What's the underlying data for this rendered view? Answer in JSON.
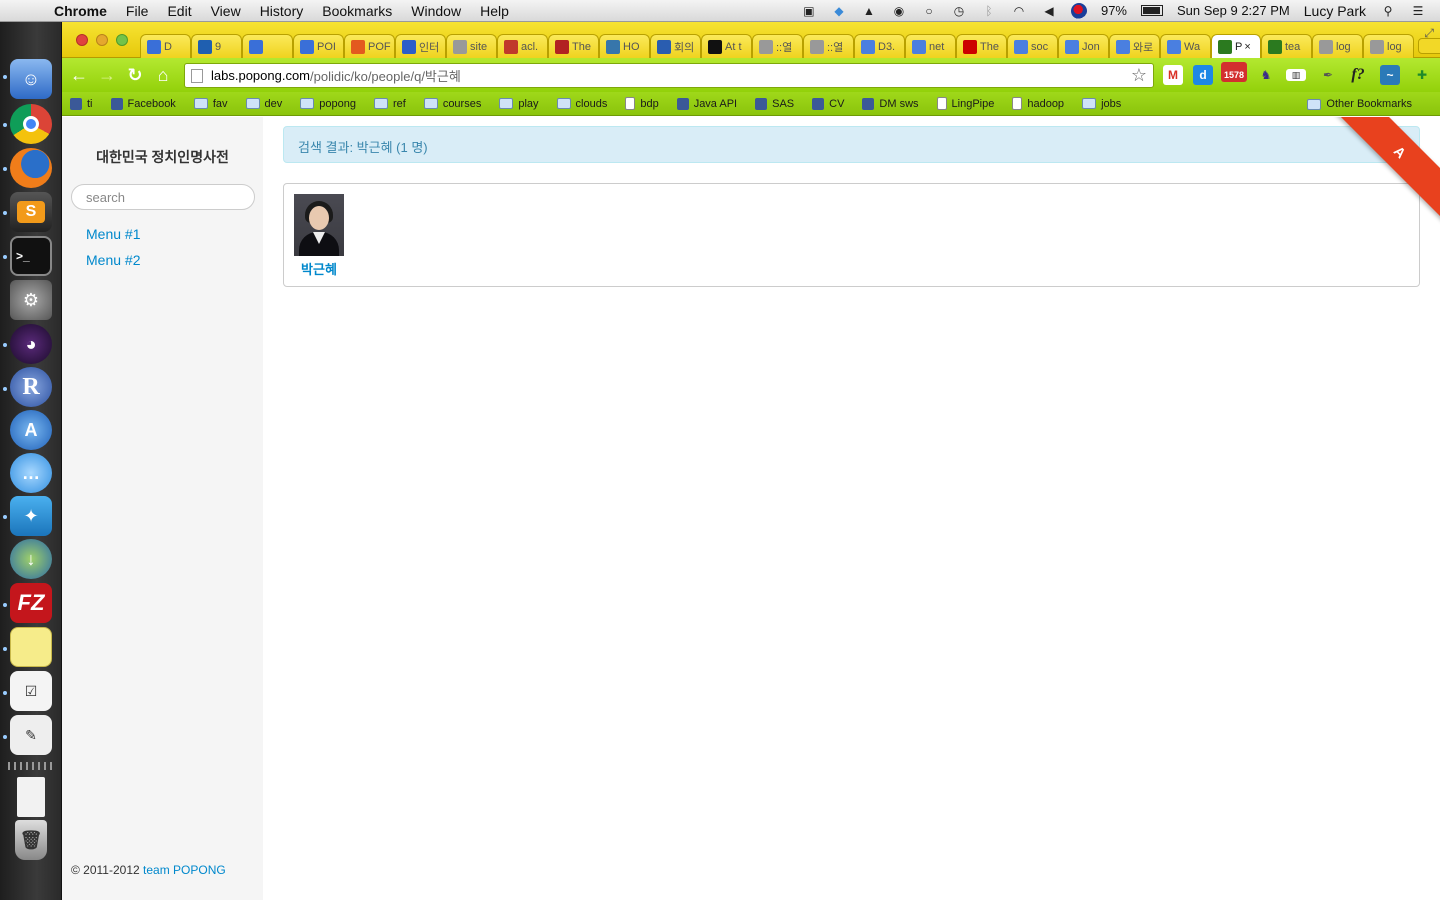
{
  "menubar": {
    "app_name": "Chrome",
    "menus": [
      "File",
      "Edit",
      "View",
      "History",
      "Bookmarks",
      "Window",
      "Help"
    ],
    "battery": "97%",
    "datetime": "Sun Sep 9  2:27 PM",
    "user": "Lucy Park"
  },
  "tabs": [
    {
      "label": "D",
      "color": "#3a6fd8"
    },
    {
      "label": "9",
      "color": "#1f5fb0"
    },
    {
      "label": "",
      "color": "#3a6fd8"
    },
    {
      "label": "POI",
      "color": "#3a6fd8"
    },
    {
      "label": "POF",
      "color": "#e35a1f"
    },
    {
      "label": "인터",
      "color": "#2c5ec9"
    },
    {
      "label": "site",
      "color": "#999999"
    },
    {
      "label": "acl.",
      "color": "#c0392b"
    },
    {
      "label": "The",
      "color": "#b22222"
    },
    {
      "label": "HO",
      "color": "#3776ab"
    },
    {
      "label": "회의",
      "color": "#2a5db0"
    },
    {
      "label": "At t",
      "color": "#111111"
    },
    {
      "label": "::열",
      "color": "#999999"
    },
    {
      "label": "::열",
      "color": "#999999"
    },
    {
      "label": "D3.",
      "color": "#4a7fe0"
    },
    {
      "label": "net",
      "color": "#4a7fe0"
    },
    {
      "label": "The",
      "color": "#cc0000"
    },
    {
      "label": "soc",
      "color": "#4a7fe0"
    },
    {
      "label": "Jon",
      "color": "#4a7fe0"
    },
    {
      "label": "와로",
      "color": "#4a7fe0"
    },
    {
      "label": "Wa",
      "color": "#4a7fe0"
    },
    {
      "label": "P",
      "color": "#2b7a1f",
      "active": true
    },
    {
      "label": "tea",
      "color": "#2b7a1f"
    },
    {
      "label": "log",
      "color": "#999999"
    },
    {
      "label": "log",
      "color": "#999999"
    }
  ],
  "omnibox": {
    "host": "labs.popong.com",
    "path": "/polidic/ko/people/q/박근혜"
  },
  "extensions": {
    "badge_count": "1578"
  },
  "bookmarks": {
    "items": [
      {
        "label": "ti",
        "kind": "site"
      },
      {
        "label": "Facebook",
        "kind": "site"
      },
      {
        "label": "fav",
        "kind": "folder"
      },
      {
        "label": "dev",
        "kind": "folder"
      },
      {
        "label": "popong",
        "kind": "folder"
      },
      {
        "label": "ref",
        "kind": "folder"
      },
      {
        "label": "courses",
        "kind": "folder"
      },
      {
        "label": "play",
        "kind": "folder"
      },
      {
        "label": "clouds",
        "kind": "folder"
      },
      {
        "label": "bdp",
        "kind": "doc"
      },
      {
        "label": "Java API",
        "kind": "site"
      },
      {
        "label": "SAS",
        "kind": "site"
      },
      {
        "label": "CV",
        "kind": "site"
      },
      {
        "label": "DM sws",
        "kind": "site"
      },
      {
        "label": "LingPipe",
        "kind": "doc"
      },
      {
        "label": "hadoop",
        "kind": "doc"
      },
      {
        "label": "jobs",
        "kind": "folder"
      }
    ],
    "other": "Other Bookmarks"
  },
  "sidebar": {
    "title": "대한민국 정치인명사전",
    "search_placeholder": "search",
    "menu": [
      "Menu #1",
      "Menu #2"
    ]
  },
  "main": {
    "alert": "검색 결과: 박근혜 (1 명)",
    "results": [
      {
        "name": "박근혜"
      }
    ]
  },
  "footer": {
    "copyright": "© 2011-2012 ",
    "team_link": "team POPONG"
  },
  "ribbon": {
    "text": "A"
  },
  "colors": {
    "link": "#0088cc",
    "alert_bg": "#d9edf7",
    "alert_text": "#3a87ad",
    "chrome_theme": "#9fd81a"
  }
}
